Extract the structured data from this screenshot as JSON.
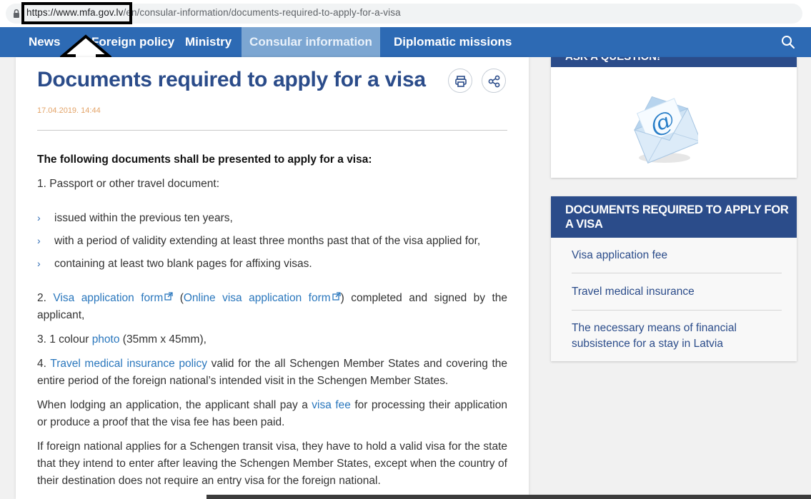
{
  "browser": {
    "url_host": "https://www.mfa.gov.lv",
    "url_path": "/en/consular-information/documents-required-to-apply-for-a-visa"
  },
  "nav": {
    "items": [
      "News",
      "Foreign policy",
      "Ministry",
      "Consular information",
      "Diplomatic missions"
    ],
    "active": "Consular information"
  },
  "article": {
    "title": "Documents required to apply for a visa",
    "date": "17.04.2019. 14:44",
    "intro": "The following documents shall be presented to apply for a visa:",
    "item1": "1. Passport or other travel document:",
    "bullets": [
      "issued within the previous ten years,",
      "with a period of validity extending at least three months past that of the visa applied for,",
      "containing at least two blank pages for affixing visas."
    ],
    "item2": {
      "num": "2. ",
      "link1": "Visa application form",
      "mid": " (",
      "link2": "Online visa application form",
      "rest": ") completed and signed by the applicant,"
    },
    "item3": {
      "pre": "3. 1 colour ",
      "link": "photo",
      "post": " (35mm x 45mm),"
    },
    "item4": {
      "pre": "4. ",
      "link": "Travel medical insurance policy",
      "post": " valid for the all Schengen Member States and covering the entire period of the foreign national’s intended visit in the Schengen Member States."
    },
    "para1": {
      "pre": "When lodging an application, the applicant shall pay a ",
      "link": "visa fee",
      "post": " for processing their application or produce a proof that the visa fee has been paid."
    },
    "para2": "If foreign national applies for a Schengen transit visa, they have to hold a valid visa for the state that they intend to enter after leaving the Schengen Member States, except when the country of their destination does not require an entry visa for the foreign national."
  },
  "sidebar": {
    "ask_title": "ASK A QUESTION!",
    "related_title": "DOCUMENTS REQUIRED TO APPLY FOR A VISA",
    "links": [
      "Visa application fee",
      "Travel medical insurance",
      "The necessary means of financial subsistence for a stay in Latvia"
    ]
  },
  "icons": [
    "lock-icon",
    "search-icon",
    "print-icon",
    "share-icon",
    "external-link-icon",
    "envelope-at-icon",
    "arrow-up-outline-icon"
  ],
  "colors": {
    "nav_bg": "#2d6ab4",
    "nav_active_bg": "#7ca6d2",
    "title": "#2b4c8a",
    "link": "#2a77bd",
    "date": "#e3a469"
  }
}
